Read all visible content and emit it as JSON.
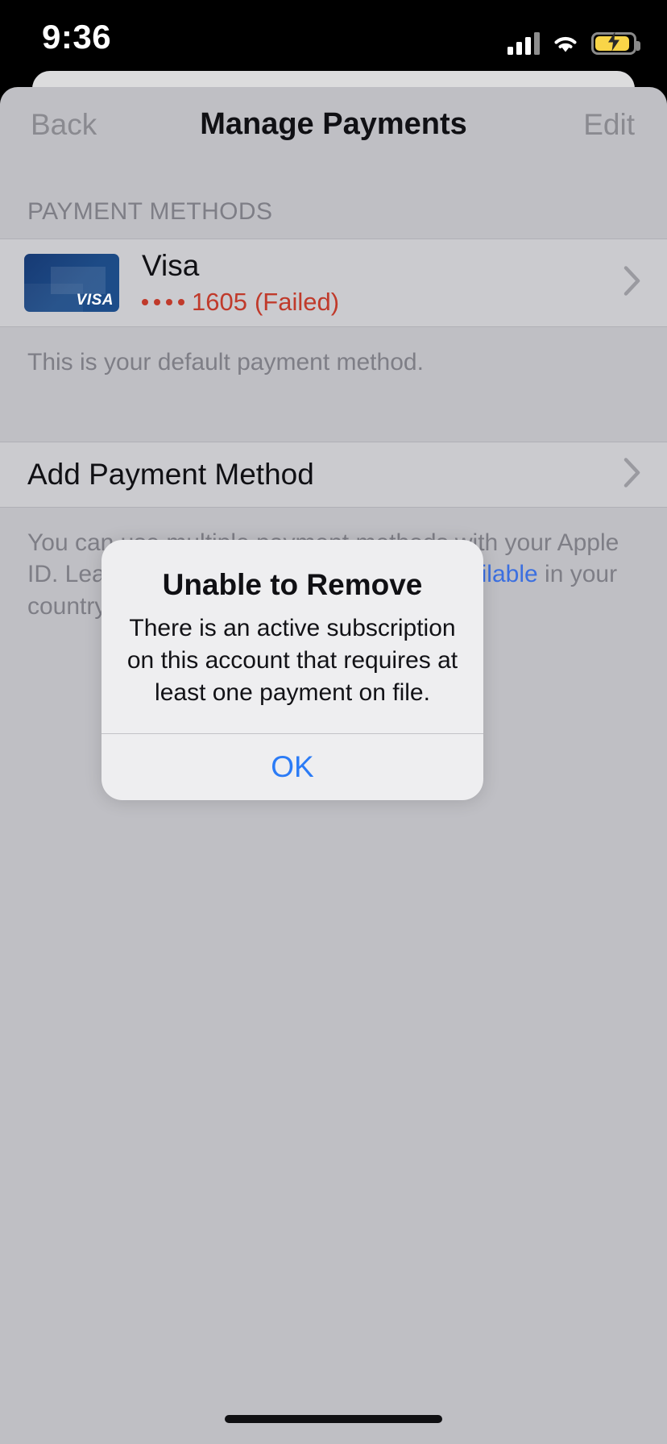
{
  "status_bar": {
    "time": "9:36",
    "cellular_icon": "cellular-bars-icon",
    "wifi_icon": "wifi-icon",
    "battery_icon": "battery-charging-icon"
  },
  "nav": {
    "back_label": "Back",
    "title": "Manage Payments",
    "edit_label": "Edit"
  },
  "payment_section": {
    "header": "PAYMENT METHODS",
    "card": {
      "brand": "Visa",
      "mask_dots": "••••",
      "last4": "1605",
      "status": "(Failed)",
      "status_color": "#c03a2b",
      "art_wordmark": "VISA",
      "chevron_icon": "chevron-right-icon"
    },
    "default_note": "This is your default payment method."
  },
  "add_payment": {
    "label": "Add Payment Method",
    "chevron_icon": "chevron-right-icon"
  },
  "footer": {
    "text_before": "You can use multiple payment methods with your Apple ID. Learn ",
    "link_text": "which payment methods are available",
    "text_after": " in your country or region.",
    "link_color": "#3b6fe0"
  },
  "alert": {
    "title": "Unable to Remove",
    "message": "There is an active subscription on this account that requires at least one payment on file.",
    "ok_label": "OK",
    "ok_color": "#2b7bf6"
  },
  "home_indicator": "home-indicator"
}
